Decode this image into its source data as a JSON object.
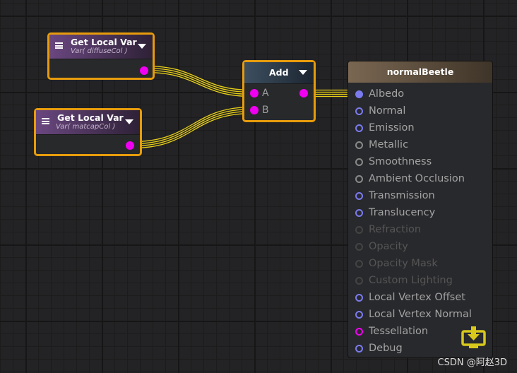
{
  "nodes": {
    "var1": {
      "title": "Get Local Var",
      "subtitle": "Var( diffuseCol )"
    },
    "var2": {
      "title": "Get Local Var",
      "subtitle": "Var( matcapCol )"
    },
    "add": {
      "title": "Add",
      "input_a": "A",
      "input_b": "B"
    }
  },
  "master": {
    "title": "normalBeetle",
    "ports": [
      {
        "label": "Albedo",
        "state": "connected"
      },
      {
        "label": "Normal",
        "state": "active"
      },
      {
        "label": "Emission",
        "state": "active"
      },
      {
        "label": "Metallic",
        "state": "gray"
      },
      {
        "label": "Smoothness",
        "state": "gray"
      },
      {
        "label": "Ambient Occlusion",
        "state": "gray"
      },
      {
        "label": "Transmission",
        "state": "active"
      },
      {
        "label": "Translucency",
        "state": "active"
      },
      {
        "label": "Refraction",
        "state": "disabled"
      },
      {
        "label": "Opacity",
        "state": "disabled"
      },
      {
        "label": "Opacity Mask",
        "state": "disabled"
      },
      {
        "label": "Custom Lighting",
        "state": "disabled"
      },
      {
        "label": "Local Vertex Offset",
        "state": "active"
      },
      {
        "label": "Local Vertex Normal",
        "state": "active"
      },
      {
        "label": "Tessellation",
        "state": "tessellation"
      },
      {
        "label": "Debug",
        "state": "active"
      }
    ]
  },
  "colors": {
    "wire": "#e8d018",
    "selection": "#e79c0c",
    "port_color": "#f000f0",
    "port_vector": "#7b7bf0"
  },
  "watermark": "CSDN @阿赵3D"
}
